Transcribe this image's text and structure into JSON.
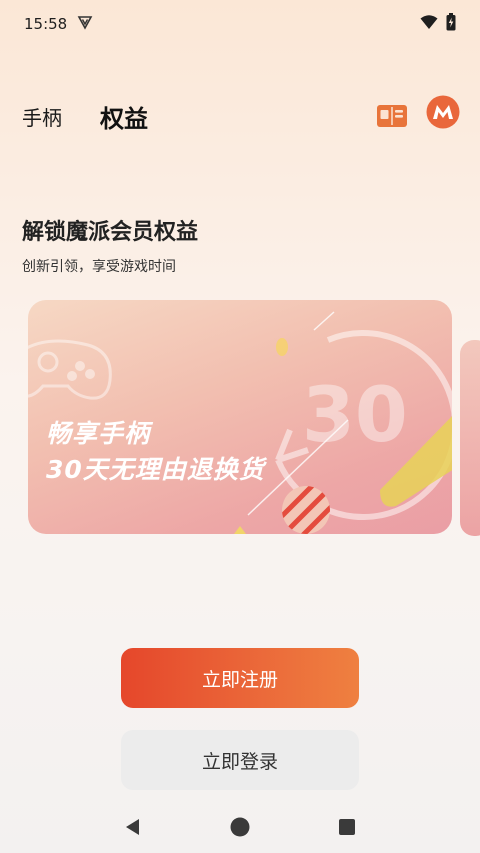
{
  "status_bar": {
    "time": "15:58",
    "icons": [
      "shield-v-icon",
      "wifi-icon",
      "battery-charging-icon"
    ]
  },
  "topnav": {
    "tab_gamepad": "手柄",
    "tab_rights": "权益",
    "icons": [
      "book-icon",
      "brand-avatar-icon"
    ]
  },
  "promo": {
    "headline": "解锁魔派会员权益",
    "subline": "创新引领，享受游戏时间"
  },
  "banner": {
    "line1": "畅享手柄",
    "line2": "30天无理由退换货",
    "big_number": "30"
  },
  "actions": {
    "register_label": "立即注册",
    "login_label": "立即登录"
  },
  "colors": {
    "accent": "#e5472b",
    "accent_end": "#ef8040",
    "book_icon": "#e8743a",
    "avatar_bg": "#e9673b"
  },
  "nav_bar": {
    "icons": [
      "back-triangle-icon",
      "home-circle-icon",
      "recents-square-icon"
    ]
  }
}
